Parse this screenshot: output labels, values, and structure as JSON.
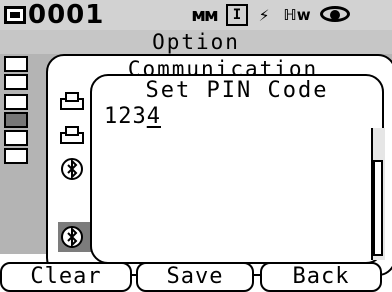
{
  "status_bar": {
    "number": "0001",
    "icons": [
      "measurement-mode-icon",
      "mask-icon",
      "bar-icon",
      "plug-icon",
      "hw-icon",
      "eye-icon"
    ]
  },
  "option": {
    "title": "Option",
    "sidebar_icons": [
      "list-icon",
      "table-icon",
      "sort-icon",
      "communication-icon",
      "tools-icon",
      "keypad-icon"
    ]
  },
  "communication": {
    "title": "Communication",
    "item_icons": [
      "printer-icon",
      "printer-icon",
      "bluetooth-icon",
      "bluetooth-icon"
    ]
  },
  "pin_dialog": {
    "title": "Set PIN Code",
    "value_prefix": "123",
    "value_cursor": "4"
  },
  "softkeys": {
    "left": "Clear",
    "center": "Save",
    "right": "Back"
  },
  "colors": {
    "status_bar": "#d2d2d2",
    "panel_gray": "#b4b4b4",
    "selection": "#7c7c7c"
  }
}
